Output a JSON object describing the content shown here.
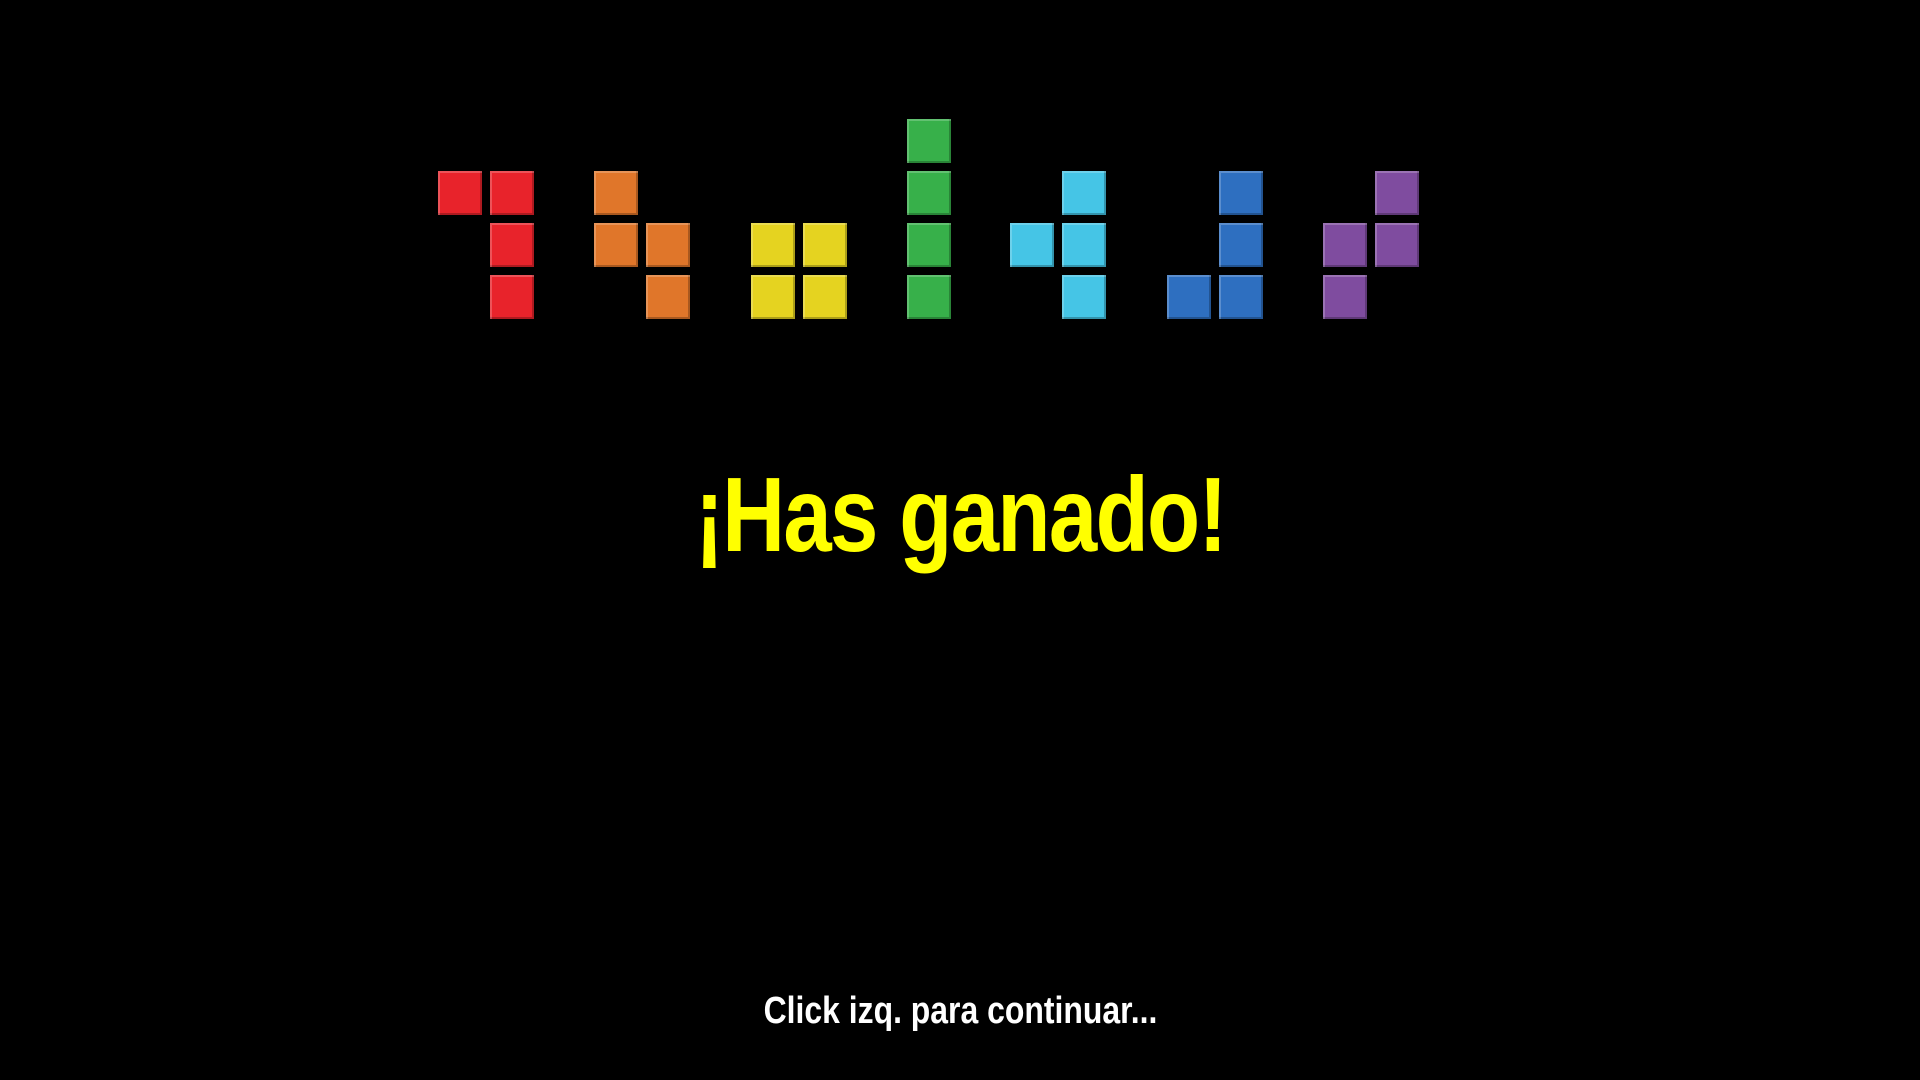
{
  "logo": {
    "pieces": [
      {
        "name": "red",
        "color": "#e8232b",
        "cells": [
          [
            0,
            0
          ],
          [
            1,
            0
          ],
          [
            1,
            1
          ],
          [
            1,
            2
          ]
        ]
      },
      {
        "name": "orange",
        "color": "#e0762a",
        "cells": [
          [
            0,
            0
          ],
          [
            0,
            1
          ],
          [
            1,
            1
          ],
          [
            1,
            2
          ]
        ]
      },
      {
        "name": "yellow",
        "color": "#e5d320",
        "cells": [
          [
            0,
            0
          ],
          [
            1,
            0
          ],
          [
            0,
            1
          ],
          [
            1,
            1
          ]
        ]
      },
      {
        "name": "green",
        "color": "#37b04a",
        "cells": [
          [
            0,
            0
          ],
          [
            0,
            1
          ],
          [
            0,
            2
          ],
          [
            0,
            3
          ]
        ]
      },
      {
        "name": "cyan",
        "color": "#45c5e6",
        "cells": [
          [
            1,
            0
          ],
          [
            0,
            1
          ],
          [
            1,
            1
          ],
          [
            1,
            2
          ]
        ]
      },
      {
        "name": "blue",
        "color": "#2e6fc0",
        "cells": [
          [
            1,
            0
          ],
          [
            1,
            1
          ],
          [
            0,
            2
          ],
          [
            1,
            2
          ]
        ]
      },
      {
        "name": "purple",
        "color": "#7f4c9f",
        "cells": [
          [
            1,
            0
          ],
          [
            0,
            1
          ],
          [
            1,
            1
          ],
          [
            0,
            2
          ]
        ]
      }
    ]
  },
  "message": {
    "text": "¡Has ganado!",
    "color": "#ffff00"
  },
  "prompt": {
    "text": "Click izq. para continuar...",
    "color": "#ffffff"
  }
}
